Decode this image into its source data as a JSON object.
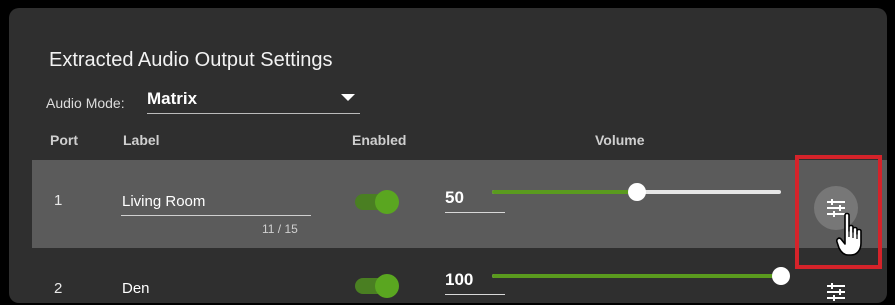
{
  "panel": {
    "title": "Extracted Audio Output Settings",
    "audio_mode_label": "Audio Mode:",
    "audio_mode_value": "Matrix"
  },
  "columns": {
    "port": "Port",
    "label": "Label",
    "enabled": "Enabled",
    "volume": "Volume"
  },
  "rows": [
    {
      "port": "1",
      "label": "Living Room",
      "char_count": "11 / 15",
      "enabled": true,
      "volume": "50",
      "volume_fraction": 0.5
    },
    {
      "port": "2",
      "label": "Den",
      "enabled": true,
      "volume": "100",
      "volume_fraction": 1.0
    }
  ],
  "icons": {
    "dropdown": "chevron-down-icon",
    "equalizer": "sliders-icon",
    "cursor": "hand-pointer-icon"
  },
  "colors": {
    "panel_bg": "#2f2f2f",
    "selected_row_bg": "#5b5b5b",
    "toggle_on": "#5aa620",
    "slider_fill": "#5a9a1e",
    "highlight_border": "#d5232a"
  }
}
